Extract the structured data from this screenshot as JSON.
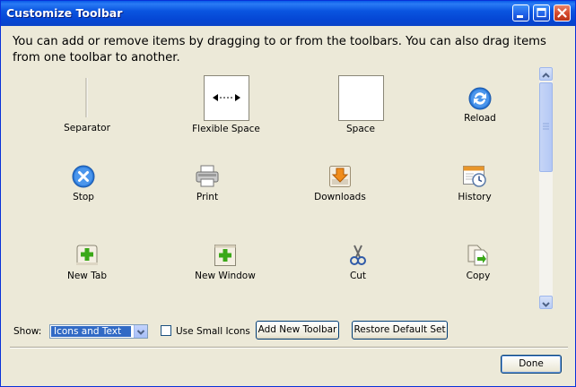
{
  "window": {
    "title": "Customize Toolbar",
    "colors": {
      "titlebar": "#0a55e0",
      "selection": "#316ac5",
      "background": "#ece9d8"
    }
  },
  "intro": {
    "text": "You can add or remove items by dragging to or from the toolbars. You can also drag items from one toolbar to another."
  },
  "palette": {
    "items": [
      {
        "label": "Separator",
        "icon": "separator-icon"
      },
      {
        "label": "Flexible Space",
        "icon": "flexible-space-icon"
      },
      {
        "label": "Space",
        "icon": "space-icon"
      },
      {
        "label": "Reload",
        "icon": "reload-icon"
      },
      {
        "label": "Stop",
        "icon": "stop-icon"
      },
      {
        "label": "Print",
        "icon": "print-icon"
      },
      {
        "label": "Downloads",
        "icon": "downloads-icon"
      },
      {
        "label": "History",
        "icon": "history-icon"
      },
      {
        "label": "New Tab",
        "icon": "new-tab-icon"
      },
      {
        "label": "New Window",
        "icon": "new-window-icon"
      },
      {
        "label": "Cut",
        "icon": "cut-icon"
      },
      {
        "label": "Copy",
        "icon": "copy-icon"
      }
    ]
  },
  "controls": {
    "show_label": "Show:",
    "show_value": "Icons and Text",
    "small_icons_label": "Use Small Icons",
    "small_icons_checked": false,
    "add_toolbar_label": "Add New Toolbar",
    "restore_label": "Restore Default Set",
    "done_label": "Done"
  }
}
